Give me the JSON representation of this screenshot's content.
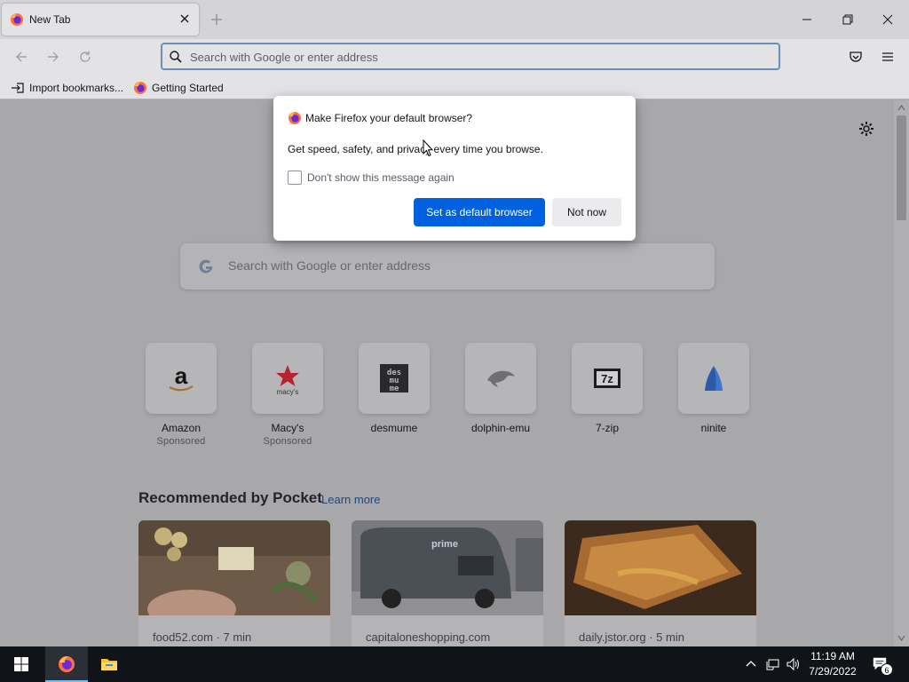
{
  "tab": {
    "title": "New Tab"
  },
  "urlbar": {
    "placeholder": "Search with Google or enter address"
  },
  "bookmarks": [
    {
      "label": "Import bookmarks..."
    },
    {
      "label": "Getting Started"
    }
  ],
  "dialog": {
    "title": "Make Firefox your default browser?",
    "message": "Get speed, safety, and privacy every time you browse.",
    "checkbox_label": "Don't show this message again",
    "checkbox_checked": false,
    "primary_button": "Set as default browser",
    "secondary_button": "Not now"
  },
  "newtab": {
    "search_placeholder": "Search with Google or enter address",
    "top_sites": [
      {
        "name": "Amazon",
        "sponsored": "Sponsored",
        "icon": "amazon-icon"
      },
      {
        "name": "Macy's",
        "sponsored": "Sponsored",
        "icon": "macys-icon"
      },
      {
        "name": "desmume",
        "icon": "desmume-icon"
      },
      {
        "name": "dolphin-emu",
        "icon": "dolphin-icon"
      },
      {
        "name": "7-zip",
        "icon": "7zip-icon"
      },
      {
        "name": "ninite",
        "icon": "ninite-icon"
      }
    ],
    "pocket": {
      "heading": "Recommended by Pocket",
      "learn_more": "Learn more",
      "cards": [
        {
          "source": "food52.com · 7 min"
        },
        {
          "source": "capitaloneshopping.com"
        },
        {
          "source": "daily.jstor.org · 5 min"
        }
      ]
    }
  },
  "taskbar": {
    "time": "11:19 AM",
    "date": "7/29/2022",
    "notification_count": "6"
  },
  "colors": {
    "accent": "#0061e0",
    "taskbar": "#101418"
  }
}
